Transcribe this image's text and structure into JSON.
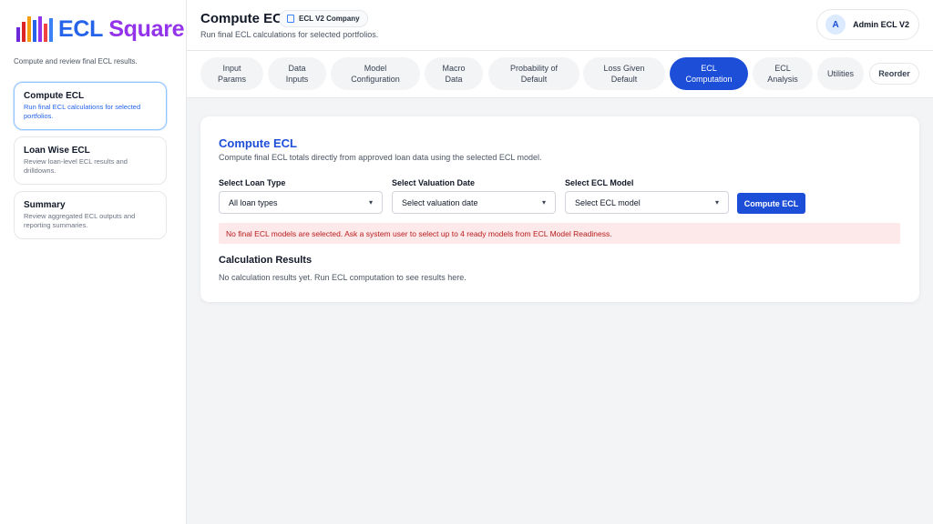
{
  "brand": {
    "logo_part1": "ECL",
    "logo_part2": "Square",
    "logo_bar_colors": [
      "#6d28d9",
      "#dc2626",
      "#f59e0b",
      "#2563eb",
      "#9333ea",
      "#ef4444",
      "#3b82f6"
    ]
  },
  "sidebar": {
    "subtitle": "Compute and review final ECL results.",
    "items": [
      {
        "title": "Compute ECL",
        "desc": "Run final ECL calculations for selected portfolios.",
        "active": true
      },
      {
        "title": "Loan Wise ECL",
        "desc": "Review loan-level ECL results and drilldowns.",
        "active": false
      },
      {
        "title": "Summary",
        "desc": "Review aggregated ECL outputs and reporting summaries.",
        "active": false
      }
    ]
  },
  "header": {
    "title": "Compute ECL",
    "company": "ECL V2 Company",
    "subtitle": "Run final ECL calculations for selected portfolios.",
    "user_initial": "A",
    "user_name": "Admin ECL V2"
  },
  "tabs": [
    {
      "label": "Input\nParams",
      "active": false
    },
    {
      "label": "Data\nInputs",
      "active": false
    },
    {
      "label": "Model\nConfiguration",
      "active": false
    },
    {
      "label": "Macro\nData",
      "active": false
    },
    {
      "label": "Probability of\nDefault",
      "active": false
    },
    {
      "label": "Loss Given\nDefault",
      "active": false
    },
    {
      "label": "ECL\nComputation",
      "active": true
    },
    {
      "label": "ECL\nAnalysis",
      "active": false
    },
    {
      "label": "Utilities",
      "active": false
    },
    {
      "label": "Reorder",
      "active": false
    }
  ],
  "main": {
    "title": "Compute ECL",
    "subtitle": "Compute final ECL totals directly from approved loan data using the selected ECL model.",
    "loan_type_label": "Select Loan Type",
    "loan_type_value": "All loan types",
    "valuation_date_label": "Select Valuation Date",
    "valuation_date_value": "Select valuation date",
    "ecl_model_label": "Select ECL Model",
    "ecl_model_value": "Select ECL model",
    "compute_button": "Compute ECL",
    "alert": "No final ECL models are selected. Ask a system user to select up to 4 ready models from ECL Model Readiness.",
    "results_title": "Calculation Results",
    "results_empty": "No calculation results yet. Run ECL computation to see results here."
  },
  "icons": {
    "select_chevron": "▾"
  }
}
